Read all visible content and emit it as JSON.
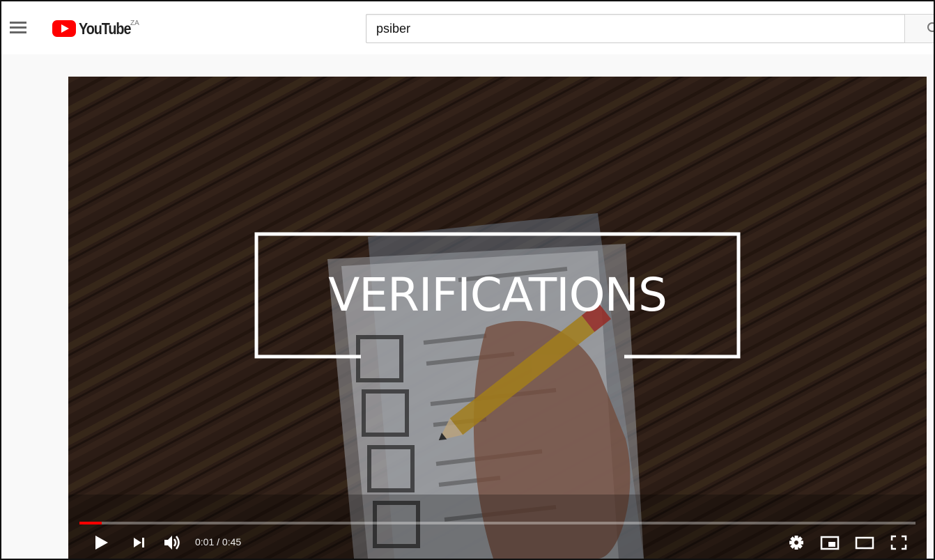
{
  "masthead": {
    "menu_icon": "hamburger-menu-icon",
    "logo_text": "YouTube",
    "region_code": "ZA",
    "search_value": "psiber",
    "search_icon": "search-icon"
  },
  "player": {
    "overlay_title": "VERIFICATIONS",
    "current_time": "0:01",
    "duration": "0:45",
    "time_display": "0:01 / 0:45",
    "progress": 0.027,
    "progress_color": "#ff0000",
    "controls": {
      "left": [
        "play-icon",
        "next-icon",
        "volume-icon"
      ],
      "right": [
        "settings-icon",
        "miniplayer-icon",
        "theater-mode-icon",
        "fullscreen-icon"
      ]
    }
  }
}
